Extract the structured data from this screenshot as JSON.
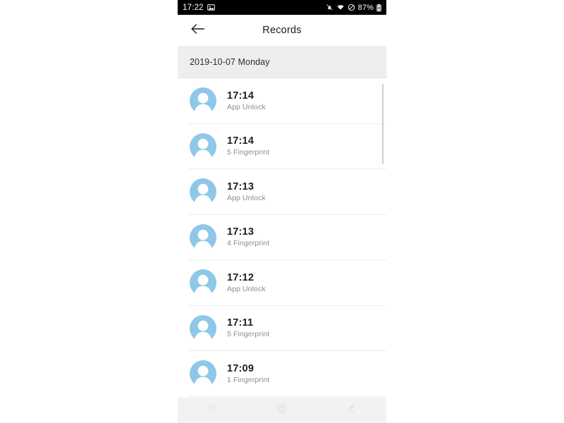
{
  "status_bar": {
    "clock": "17:22",
    "battery_percent": "87%",
    "icons": {
      "photo": "photo-icon",
      "mute": "bell-muted-icon",
      "wifi": "wifi-icon",
      "dnd": "do-not-disturb-icon",
      "battery": "battery-icon"
    },
    "background": "#000000",
    "foreground": "#ffffff"
  },
  "app_bar": {
    "back_label": "back-arrow",
    "title": "Records"
  },
  "date_header": {
    "label": "2019-10-07 Monday",
    "background": "#eeeeee"
  },
  "records": [
    {
      "time": "17:14",
      "type": "App Unlock"
    },
    {
      "time": "17:14",
      "type": "5 Fingerprint"
    },
    {
      "time": "17:13",
      "type": "App Unlock"
    },
    {
      "time": "17:13",
      "type": "4 Fingerprint"
    },
    {
      "time": "17:12",
      "type": "App Unlock"
    },
    {
      "time": "17:11",
      "type": "5 Fingerprint"
    },
    {
      "time": "17:09",
      "type": "1 Fingerprint"
    }
  ],
  "avatar": {
    "name": "user-avatar-icon",
    "color": "#8ec7e8",
    "silhouette_color": "#ffffff"
  },
  "scrollbar": {
    "name": "vertical-scrollbar",
    "color": "#cfcfcf"
  },
  "nav_bar": {
    "recents": "recents-icon",
    "home": "home-icon",
    "back": "back-icon",
    "background": "#f2f2f2"
  }
}
